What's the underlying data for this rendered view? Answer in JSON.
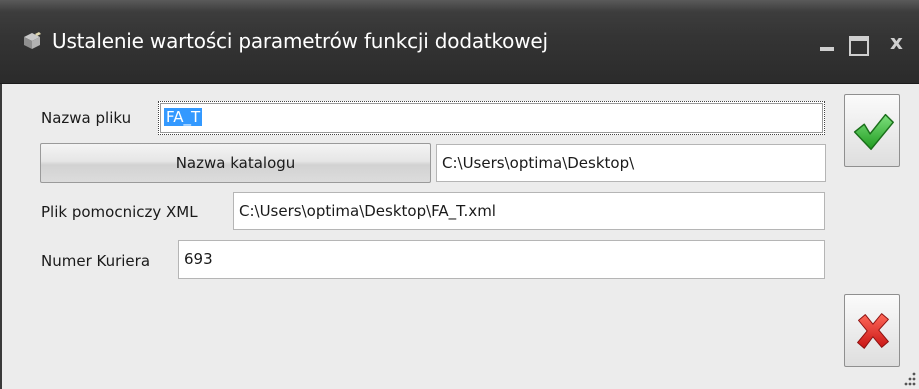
{
  "window": {
    "title": "Ustalenie wartości parametrów funkcji dodatkowej",
    "controls": {
      "minimize": "_",
      "maximize": "□",
      "close": "x"
    }
  },
  "form": {
    "file_name": {
      "label": "Nazwa pliku",
      "value": "FA_T"
    },
    "catalog": {
      "button_label": "Nazwa katalogu",
      "value": "C:\\Users\\optima\\Desktop\\"
    },
    "xml_helper": {
      "label": "Plik pomocniczy XML",
      "value": "C:\\Users\\optima\\Desktop\\FA_T.xml"
    },
    "courier_number": {
      "label": "Numer Kuriera",
      "value": "693"
    }
  },
  "actions": {
    "ok_icon": "green-checkmark-icon",
    "cancel_icon": "red-x-icon"
  },
  "colors": {
    "titlebar": "#343434",
    "selection": "#3399ff",
    "ok_green": "#2db82d",
    "cancel_red": "#e02020"
  }
}
